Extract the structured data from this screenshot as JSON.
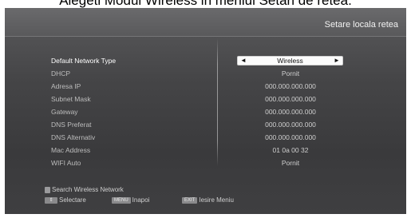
{
  "caption": "Alegeti Modul Wireless in meniul Setari de retea.",
  "screen_title": "Setare locala retea",
  "rows": [
    {
      "label": "Default Network Type",
      "value": "Wireless",
      "active": true
    },
    {
      "label": "DHCP",
      "value": "Pornit"
    },
    {
      "label": "Adresa IP",
      "value": "000.000.000.000"
    },
    {
      "label": "Subnet Mask",
      "value": "000.000.000.000"
    },
    {
      "label": "Gateway",
      "value": "000.000.000.000"
    },
    {
      "label": "DNS Preferat",
      "value": "000.000.000.000"
    },
    {
      "label": "DNS Alternativ",
      "value": "000.000.000.000"
    },
    {
      "label": "Mac Address",
      "value": "01 0a 00 32"
    },
    {
      "label": "WIFI Auto",
      "value": "Pornit"
    }
  ],
  "footer": {
    "search_label": "Search Wireless Network",
    "select_label": "Selectare",
    "menu_key": "MENU",
    "back_label": "Inapoi",
    "exit_key": "EXIT",
    "exit_label": "Iesire Meniu"
  },
  "icons": {
    "left_arrow": "◄",
    "right_arrow": "►",
    "updown_arrow": "⇕"
  }
}
